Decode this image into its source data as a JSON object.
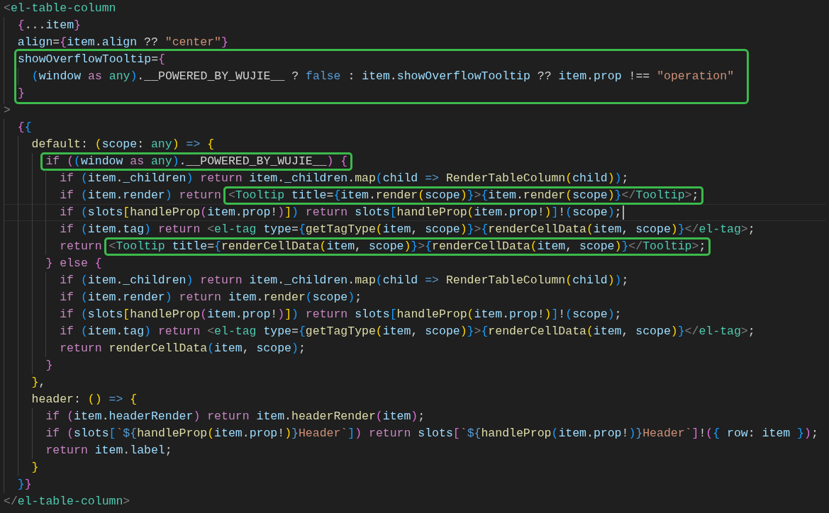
{
  "editor": {
    "lines": [
      {
        "kind": "line",
        "current": false,
        "tokens": [
          {
            "kind": "br",
            "text": "<"
          },
          {
            "kind": "tag",
            "text": "el-table-column"
          }
        ]
      },
      {
        "kind": "line",
        "current": false,
        "tokens": [
          {
            "kind": "b2",
            "text": "  {"
          },
          {
            "kind": "p",
            "text": "..."
          },
          {
            "kind": "attr",
            "text": "item"
          },
          {
            "kind": "b2",
            "text": "}"
          }
        ]
      },
      {
        "kind": "line",
        "current": false,
        "tokens": [
          {
            "kind": "attr",
            "text": "  align"
          },
          {
            "kind": "p",
            "text": "="
          },
          {
            "kind": "b2",
            "text": "{"
          },
          {
            "kind": "attr",
            "text": "item"
          },
          {
            "kind": "p",
            "text": "."
          },
          {
            "kind": "attr",
            "text": "align"
          },
          {
            "kind": "p",
            "text": " ?? "
          },
          {
            "kind": "str",
            "text": "\"center\""
          },
          {
            "kind": "b2",
            "text": "}"
          }
        ]
      },
      {
        "kind": "highlight",
        "lines": [
          {
            "kind": "line",
            "current": false,
            "tokens": [
              {
                "kind": "attr",
                "text": "  showOverflowTooltip"
              },
              {
                "kind": "p",
                "text": "="
              },
              {
                "kind": "b2",
                "text": "{"
              }
            ]
          },
          {
            "kind": "line",
            "current": false,
            "tokens": [
              {
                "kind": "b3",
                "text": "    ("
              },
              {
                "kind": "attr",
                "text": "window"
              },
              {
                "kind": "ctl",
                "text": " as "
              },
              {
                "kind": "type",
                "text": "any"
              },
              {
                "kind": "b3",
                "text": ")"
              },
              {
                "kind": "p",
                "text": ".__POWERED_BY_WUJIE__ ? "
              },
              {
                "kind": "kw",
                "text": "false"
              },
              {
                "kind": "p",
                "text": " : "
              },
              {
                "kind": "attr",
                "text": "item"
              },
              {
                "kind": "p",
                "text": "."
              },
              {
                "kind": "attr",
                "text": "showOverflowTooltip"
              },
              {
                "kind": "p",
                "text": " ?? "
              },
              {
                "kind": "attr",
                "text": "item"
              },
              {
                "kind": "p",
                "text": "."
              },
              {
                "kind": "attr",
                "text": "prop"
              },
              {
                "kind": "p",
                "text": " !== "
              },
              {
                "kind": "str",
                "text": "\"operation\""
              }
            ]
          },
          {
            "kind": "line",
            "current": false,
            "tokens": [
              {
                "kind": "b2",
                "text": "  }"
              }
            ]
          }
        ]
      },
      {
        "kind": "line",
        "current": false,
        "tokens": [
          {
            "kind": "br",
            "text": ">"
          }
        ]
      },
      {
        "kind": "line",
        "current": false,
        "tokens": [
          {
            "kind": "b2",
            "text": "  {"
          },
          {
            "kind": "b3",
            "text": "{"
          }
        ]
      },
      {
        "kind": "line",
        "current": false,
        "tokens": [
          {
            "kind": "fn",
            "text": "    default"
          },
          {
            "kind": "p",
            "text": ": "
          },
          {
            "kind": "b1",
            "text": "("
          },
          {
            "kind": "attr",
            "text": "scope"
          },
          {
            "kind": "p",
            "text": ": "
          },
          {
            "kind": "type",
            "text": "any"
          },
          {
            "kind": "b1",
            "text": ")"
          },
          {
            "kind": "kw",
            "text": " => "
          },
          {
            "kind": "b1",
            "text": "{"
          }
        ]
      },
      {
        "kind": "line",
        "current": false,
        "tokens": [
          {
            "kind": "box",
            "tokens": [
              {
                "kind": "ctl",
                "text": "      if "
              },
              {
                "kind": "b2",
                "text": "("
              },
              {
                "kind": "b3",
                "text": "("
              },
              {
                "kind": "attr",
                "text": "window"
              },
              {
                "kind": "ctl",
                "text": " as "
              },
              {
                "kind": "type",
                "text": "any"
              },
              {
                "kind": "b3",
                "text": ")"
              },
              {
                "kind": "p",
                "text": ".__POWERED_BY_WUJIE__"
              },
              {
                "kind": "b2",
                "text": ") {"
              }
            ]
          }
        ]
      },
      {
        "kind": "line",
        "current": false,
        "tokens": [
          {
            "kind": "ctl",
            "text": "        if "
          },
          {
            "kind": "b3",
            "text": "("
          },
          {
            "kind": "attr",
            "text": "item"
          },
          {
            "kind": "p",
            "text": "."
          },
          {
            "kind": "attr",
            "text": "_children"
          },
          {
            "kind": "b3",
            "text": ") "
          },
          {
            "kind": "ctl",
            "text": "return "
          },
          {
            "kind": "attr",
            "text": "item"
          },
          {
            "kind": "p",
            "text": "."
          },
          {
            "kind": "attr",
            "text": "_children"
          },
          {
            "kind": "p",
            "text": "."
          },
          {
            "kind": "fn",
            "text": "map"
          },
          {
            "kind": "b3",
            "text": "("
          },
          {
            "kind": "attr",
            "text": "child"
          },
          {
            "kind": "kw",
            "text": " => "
          },
          {
            "kind": "fn",
            "text": "RenderTableColumn"
          },
          {
            "kind": "b1",
            "text": "("
          },
          {
            "kind": "attr",
            "text": "child"
          },
          {
            "kind": "b1",
            "text": ")"
          },
          {
            "kind": "b3",
            "text": ")"
          },
          {
            "kind": "p",
            "text": ";"
          }
        ]
      },
      {
        "kind": "line",
        "current": false,
        "tokens": [
          {
            "kind": "ctl",
            "text": "        if "
          },
          {
            "kind": "b3",
            "text": "("
          },
          {
            "kind": "attr",
            "text": "item"
          },
          {
            "kind": "p",
            "text": "."
          },
          {
            "kind": "attr",
            "text": "render"
          },
          {
            "kind": "b3",
            "text": ") "
          },
          {
            "kind": "ctl",
            "text": "return "
          },
          {
            "kind": "box",
            "tokens": [
              {
                "kind": "br",
                "text": "<"
              },
              {
                "kind": "tag",
                "text": "Tooltip "
              },
              {
                "kind": "attr",
                "text": "title"
              },
              {
                "kind": "p",
                "text": "="
              },
              {
                "kind": "b3",
                "text": "{"
              },
              {
                "kind": "attr",
                "text": "item"
              },
              {
                "kind": "p",
                "text": "."
              },
              {
                "kind": "fn",
                "text": "render"
              },
              {
                "kind": "b1",
                "text": "("
              },
              {
                "kind": "attr",
                "text": "scope"
              },
              {
                "kind": "b1",
                "text": ")"
              },
              {
                "kind": "b3",
                "text": "}"
              },
              {
                "kind": "br",
                "text": ">"
              },
              {
                "kind": "b3",
                "text": "{"
              },
              {
                "kind": "attr",
                "text": "item"
              },
              {
                "kind": "p",
                "text": "."
              },
              {
                "kind": "fn",
                "text": "render"
              },
              {
                "kind": "b1",
                "text": "("
              },
              {
                "kind": "attr",
                "text": "scope"
              },
              {
                "kind": "b1",
                "text": ")"
              },
              {
                "kind": "b3",
                "text": "}"
              },
              {
                "kind": "br",
                "text": "</"
              },
              {
                "kind": "tag",
                "text": "Tooltip"
              },
              {
                "kind": "br",
                "text": ">"
              },
              {
                "kind": "p",
                "text": ";"
              }
            ]
          }
        ]
      },
      {
        "kind": "line",
        "current": true,
        "tokens": [
          {
            "kind": "ctl",
            "text": "        if "
          },
          {
            "kind": "b3",
            "text": "("
          },
          {
            "kind": "attr",
            "text": "slots"
          },
          {
            "kind": "b1",
            "text": "["
          },
          {
            "kind": "fn",
            "text": "handleProp"
          },
          {
            "kind": "b2",
            "text": "("
          },
          {
            "kind": "attr",
            "text": "item"
          },
          {
            "kind": "p",
            "text": "."
          },
          {
            "kind": "attr",
            "text": "prop"
          },
          {
            "kind": "p",
            "text": "!"
          },
          {
            "kind": "b2",
            "text": ")"
          },
          {
            "kind": "b1",
            "text": "]"
          },
          {
            "kind": "b3",
            "text": ") "
          },
          {
            "kind": "ctl",
            "text": "return "
          },
          {
            "kind": "attr",
            "text": "slots"
          },
          {
            "kind": "b3",
            "text": "["
          },
          {
            "kind": "fn",
            "text": "handleProp"
          },
          {
            "kind": "b1",
            "text": "("
          },
          {
            "kind": "attr",
            "text": "item"
          },
          {
            "kind": "p",
            "text": "."
          },
          {
            "kind": "attr",
            "text": "prop"
          },
          {
            "kind": "p",
            "text": "!"
          },
          {
            "kind": "b1",
            "text": ")"
          },
          {
            "kind": "b3",
            "text": "]"
          },
          {
            "kind": "p",
            "text": "!"
          },
          {
            "kind": "b3",
            "text": "("
          },
          {
            "kind": "attr",
            "text": "scope"
          },
          {
            "kind": "b3",
            "text": ")"
          },
          {
            "kind": "p",
            "text": ";"
          }
        ]
      },
      {
        "kind": "line",
        "current": false,
        "tokens": [
          {
            "kind": "ctl",
            "text": "        if "
          },
          {
            "kind": "b3",
            "text": "("
          },
          {
            "kind": "attr",
            "text": "item"
          },
          {
            "kind": "p",
            "text": "."
          },
          {
            "kind": "attr",
            "text": "tag"
          },
          {
            "kind": "b3",
            "text": ") "
          },
          {
            "kind": "ctl",
            "text": "return "
          },
          {
            "kind": "br",
            "text": "<"
          },
          {
            "kind": "tag",
            "text": "el-tag "
          },
          {
            "kind": "attr",
            "text": "type"
          },
          {
            "kind": "p",
            "text": "="
          },
          {
            "kind": "b3",
            "text": "{"
          },
          {
            "kind": "fn",
            "text": "getTagType"
          },
          {
            "kind": "b1",
            "text": "("
          },
          {
            "kind": "attr",
            "text": "item"
          },
          {
            "kind": "p",
            "text": ", "
          },
          {
            "kind": "attr",
            "text": "scope"
          },
          {
            "kind": "b1",
            "text": ")"
          },
          {
            "kind": "b3",
            "text": "}"
          },
          {
            "kind": "br",
            "text": ">"
          },
          {
            "kind": "b3",
            "text": "{"
          },
          {
            "kind": "fn",
            "text": "renderCellData"
          },
          {
            "kind": "b1",
            "text": "("
          },
          {
            "kind": "attr",
            "text": "item"
          },
          {
            "kind": "p",
            "text": ", "
          },
          {
            "kind": "attr",
            "text": "scope"
          },
          {
            "kind": "b1",
            "text": ")"
          },
          {
            "kind": "b3",
            "text": "}"
          },
          {
            "kind": "br",
            "text": "</"
          },
          {
            "kind": "tag",
            "text": "el-tag"
          },
          {
            "kind": "br",
            "text": ">"
          },
          {
            "kind": "p",
            "text": ";"
          }
        ]
      },
      {
        "kind": "line",
        "current": false,
        "tokens": [
          {
            "kind": "ctl",
            "text": "        return "
          },
          {
            "kind": "box",
            "tokens": [
              {
                "kind": "br",
                "text": "<"
              },
              {
                "kind": "tag",
                "text": "Tooltip "
              },
              {
                "kind": "attr",
                "text": "title"
              },
              {
                "kind": "p",
                "text": "="
              },
              {
                "kind": "b3",
                "text": "{"
              },
              {
                "kind": "fn",
                "text": "renderCellData"
              },
              {
                "kind": "b1",
                "text": "("
              },
              {
                "kind": "attr",
                "text": "item"
              },
              {
                "kind": "p",
                "text": ", "
              },
              {
                "kind": "attr",
                "text": "scope"
              },
              {
                "kind": "b1",
                "text": ")"
              },
              {
                "kind": "b3",
                "text": "}"
              },
              {
                "kind": "br",
                "text": ">"
              },
              {
                "kind": "b3",
                "text": "{"
              },
              {
                "kind": "fn",
                "text": "renderCellData"
              },
              {
                "kind": "b1",
                "text": "("
              },
              {
                "kind": "attr",
                "text": "item"
              },
              {
                "kind": "p",
                "text": ", "
              },
              {
                "kind": "attr",
                "text": "scope"
              },
              {
                "kind": "b1",
                "text": ")"
              },
              {
                "kind": "b3",
                "text": "}"
              },
              {
                "kind": "br",
                "text": "</"
              },
              {
                "kind": "tag",
                "text": "Tooltip"
              },
              {
                "kind": "br",
                "text": ">"
              },
              {
                "kind": "p",
                "text": ";"
              }
            ]
          }
        ]
      },
      {
        "kind": "line",
        "current": false,
        "tokens": [
          {
            "kind": "b2",
            "text": "      } "
          },
          {
            "kind": "ctl",
            "text": "else "
          },
          {
            "kind": "b2",
            "text": "{"
          }
        ]
      },
      {
        "kind": "line",
        "current": false,
        "tokens": [
          {
            "kind": "ctl",
            "text": "        if "
          },
          {
            "kind": "b3",
            "text": "("
          },
          {
            "kind": "attr",
            "text": "item"
          },
          {
            "kind": "p",
            "text": "."
          },
          {
            "kind": "attr",
            "text": "_children"
          },
          {
            "kind": "b3",
            "text": ") "
          },
          {
            "kind": "ctl",
            "text": "return "
          },
          {
            "kind": "attr",
            "text": "item"
          },
          {
            "kind": "p",
            "text": "."
          },
          {
            "kind": "attr",
            "text": "_children"
          },
          {
            "kind": "p",
            "text": "."
          },
          {
            "kind": "fn",
            "text": "map"
          },
          {
            "kind": "b3",
            "text": "("
          },
          {
            "kind": "attr",
            "text": "child"
          },
          {
            "kind": "kw",
            "text": " => "
          },
          {
            "kind": "fn",
            "text": "RenderTableColumn"
          },
          {
            "kind": "b1",
            "text": "("
          },
          {
            "kind": "attr",
            "text": "child"
          },
          {
            "kind": "b1",
            "text": ")"
          },
          {
            "kind": "b3",
            "text": ")"
          },
          {
            "kind": "p",
            "text": ";"
          }
        ]
      },
      {
        "kind": "line",
        "current": false,
        "tokens": [
          {
            "kind": "ctl",
            "text": "        if "
          },
          {
            "kind": "b3",
            "text": "("
          },
          {
            "kind": "attr",
            "text": "item"
          },
          {
            "kind": "p",
            "text": "."
          },
          {
            "kind": "attr",
            "text": "render"
          },
          {
            "kind": "b3",
            "text": ") "
          },
          {
            "kind": "ctl",
            "text": "return "
          },
          {
            "kind": "attr",
            "text": "item"
          },
          {
            "kind": "p",
            "text": "."
          },
          {
            "kind": "fn",
            "text": "render"
          },
          {
            "kind": "b3",
            "text": "("
          },
          {
            "kind": "attr",
            "text": "scope"
          },
          {
            "kind": "b3",
            "text": ")"
          },
          {
            "kind": "p",
            "text": ";"
          }
        ]
      },
      {
        "kind": "line",
        "current": false,
        "tokens": [
          {
            "kind": "ctl",
            "text": "        if "
          },
          {
            "kind": "b3",
            "text": "("
          },
          {
            "kind": "attr",
            "text": "slots"
          },
          {
            "kind": "b1",
            "text": "["
          },
          {
            "kind": "fn",
            "text": "handleProp"
          },
          {
            "kind": "b2",
            "text": "("
          },
          {
            "kind": "attr",
            "text": "item"
          },
          {
            "kind": "p",
            "text": "."
          },
          {
            "kind": "attr",
            "text": "prop"
          },
          {
            "kind": "p",
            "text": "!"
          },
          {
            "kind": "b2",
            "text": ")"
          },
          {
            "kind": "b1",
            "text": "]"
          },
          {
            "kind": "b3",
            "text": ") "
          },
          {
            "kind": "ctl",
            "text": "return "
          },
          {
            "kind": "attr",
            "text": "slots"
          },
          {
            "kind": "b3",
            "text": "["
          },
          {
            "kind": "fn",
            "text": "handleProp"
          },
          {
            "kind": "b1",
            "text": "("
          },
          {
            "kind": "attr",
            "text": "item"
          },
          {
            "kind": "p",
            "text": "."
          },
          {
            "kind": "attr",
            "text": "prop"
          },
          {
            "kind": "p",
            "text": "!"
          },
          {
            "kind": "b1",
            "text": ")"
          },
          {
            "kind": "b3",
            "text": "]"
          },
          {
            "kind": "p",
            "text": "!"
          },
          {
            "kind": "b3",
            "text": "("
          },
          {
            "kind": "attr",
            "text": "scope"
          },
          {
            "kind": "b3",
            "text": ")"
          },
          {
            "kind": "p",
            "text": ";"
          }
        ]
      },
      {
        "kind": "line",
        "current": false,
        "tokens": [
          {
            "kind": "ctl",
            "text": "        if "
          },
          {
            "kind": "b3",
            "text": "("
          },
          {
            "kind": "attr",
            "text": "item"
          },
          {
            "kind": "p",
            "text": "."
          },
          {
            "kind": "attr",
            "text": "tag"
          },
          {
            "kind": "b3",
            "text": ") "
          },
          {
            "kind": "ctl",
            "text": "return "
          },
          {
            "kind": "br",
            "text": "<"
          },
          {
            "kind": "tag",
            "text": "el-tag "
          },
          {
            "kind": "attr",
            "text": "type"
          },
          {
            "kind": "p",
            "text": "="
          },
          {
            "kind": "b3",
            "text": "{"
          },
          {
            "kind": "fn",
            "text": "getTagType"
          },
          {
            "kind": "b1",
            "text": "("
          },
          {
            "kind": "attr",
            "text": "item"
          },
          {
            "kind": "p",
            "text": ", "
          },
          {
            "kind": "attr",
            "text": "scope"
          },
          {
            "kind": "b1",
            "text": ")"
          },
          {
            "kind": "b3",
            "text": "}"
          },
          {
            "kind": "br",
            "text": ">"
          },
          {
            "kind": "b3",
            "text": "{"
          },
          {
            "kind": "fn",
            "text": "renderCellData"
          },
          {
            "kind": "b1",
            "text": "("
          },
          {
            "kind": "attr",
            "text": "item"
          },
          {
            "kind": "p",
            "text": ", "
          },
          {
            "kind": "attr",
            "text": "scope"
          },
          {
            "kind": "b1",
            "text": ")"
          },
          {
            "kind": "b3",
            "text": "}"
          },
          {
            "kind": "br",
            "text": "</"
          },
          {
            "kind": "tag",
            "text": "el-tag"
          },
          {
            "kind": "br",
            "text": ">"
          },
          {
            "kind": "p",
            "text": ";"
          }
        ]
      },
      {
        "kind": "line",
        "current": false,
        "tokens": [
          {
            "kind": "ctl",
            "text": "        return "
          },
          {
            "kind": "fn",
            "text": "renderCellData"
          },
          {
            "kind": "b3",
            "text": "("
          },
          {
            "kind": "attr",
            "text": "item"
          },
          {
            "kind": "p",
            "text": ", "
          },
          {
            "kind": "attr",
            "text": "scope"
          },
          {
            "kind": "b3",
            "text": ")"
          },
          {
            "kind": "p",
            "text": ";"
          }
        ]
      },
      {
        "kind": "line",
        "current": false,
        "tokens": [
          {
            "kind": "b2",
            "text": "      }"
          }
        ]
      },
      {
        "kind": "line",
        "current": false,
        "tokens": [
          {
            "kind": "b1",
            "text": "    }"
          },
          {
            "kind": "p",
            "text": ","
          }
        ]
      },
      {
        "kind": "line",
        "current": false,
        "tokens": [
          {
            "kind": "fn",
            "text": "    header"
          },
          {
            "kind": "p",
            "text": ": "
          },
          {
            "kind": "b1",
            "text": "()"
          },
          {
            "kind": "kw",
            "text": " => "
          },
          {
            "kind": "b1",
            "text": "{"
          }
        ]
      },
      {
        "kind": "line",
        "current": false,
        "tokens": [
          {
            "kind": "ctl",
            "text": "      if "
          },
          {
            "kind": "b2",
            "text": "("
          },
          {
            "kind": "attr",
            "text": "item"
          },
          {
            "kind": "p",
            "text": "."
          },
          {
            "kind": "attr",
            "text": "headerRender"
          },
          {
            "kind": "b2",
            "text": ") "
          },
          {
            "kind": "ctl",
            "text": "return "
          },
          {
            "kind": "attr",
            "text": "item"
          },
          {
            "kind": "p",
            "text": "."
          },
          {
            "kind": "fn",
            "text": "headerRender"
          },
          {
            "kind": "b2",
            "text": "("
          },
          {
            "kind": "attr",
            "text": "item"
          },
          {
            "kind": "b2",
            "text": ")"
          },
          {
            "kind": "p",
            "text": ";"
          }
        ]
      },
      {
        "kind": "line",
        "current": false,
        "tokens": [
          {
            "kind": "ctl",
            "text": "      if "
          },
          {
            "kind": "b2",
            "text": "("
          },
          {
            "kind": "attr",
            "text": "slots"
          },
          {
            "kind": "b3",
            "text": "["
          },
          {
            "kind": "str",
            "text": "`"
          },
          {
            "kind": "kw",
            "text": "${"
          },
          {
            "kind": "fn",
            "text": "handleProp"
          },
          {
            "kind": "b1",
            "text": "("
          },
          {
            "kind": "attr",
            "text": "item"
          },
          {
            "kind": "p",
            "text": "."
          },
          {
            "kind": "attr",
            "text": "prop"
          },
          {
            "kind": "p",
            "text": "!"
          },
          {
            "kind": "b1",
            "text": ")"
          },
          {
            "kind": "kw",
            "text": "}"
          },
          {
            "kind": "str",
            "text": "Header`"
          },
          {
            "kind": "b3",
            "text": "]"
          },
          {
            "kind": "b2",
            "text": ") "
          },
          {
            "kind": "ctl",
            "text": "return "
          },
          {
            "kind": "attr",
            "text": "slots"
          },
          {
            "kind": "b2",
            "text": "["
          },
          {
            "kind": "str",
            "text": "`"
          },
          {
            "kind": "kw",
            "text": "${"
          },
          {
            "kind": "fn",
            "text": "handleProp"
          },
          {
            "kind": "b3",
            "text": "("
          },
          {
            "kind": "attr",
            "text": "item"
          },
          {
            "kind": "p",
            "text": "."
          },
          {
            "kind": "attr",
            "text": "prop"
          },
          {
            "kind": "p",
            "text": "!"
          },
          {
            "kind": "b3",
            "text": ")"
          },
          {
            "kind": "kw",
            "text": "}"
          },
          {
            "kind": "str",
            "text": "Header`"
          },
          {
            "kind": "b2",
            "text": "]"
          },
          {
            "kind": "p",
            "text": "!"
          },
          {
            "kind": "b2",
            "text": "("
          },
          {
            "kind": "b3",
            "text": "{ "
          },
          {
            "kind": "attr",
            "text": "row"
          },
          {
            "kind": "p",
            "text": ": "
          },
          {
            "kind": "attr",
            "text": "item "
          },
          {
            "kind": "b3",
            "text": "}"
          },
          {
            "kind": "b2",
            "text": ")"
          },
          {
            "kind": "p",
            "text": ";"
          }
        ]
      },
      {
        "kind": "line",
        "current": false,
        "tokens": [
          {
            "kind": "ctl",
            "text": "      return "
          },
          {
            "kind": "attr",
            "text": "item"
          },
          {
            "kind": "p",
            "text": "."
          },
          {
            "kind": "attr",
            "text": "label"
          },
          {
            "kind": "p",
            "text": ";"
          }
        ]
      },
      {
        "kind": "line",
        "current": false,
        "tokens": [
          {
            "kind": "b1",
            "text": "    }"
          }
        ]
      },
      {
        "kind": "line",
        "current": false,
        "tokens": [
          {
            "kind": "b3",
            "text": "  }"
          },
          {
            "kind": "b2",
            "text": "}"
          }
        ]
      },
      {
        "kind": "line",
        "current": false,
        "tokens": [
          {
            "kind": "br",
            "text": "</"
          },
          {
            "kind": "tag",
            "text": "el-table-column"
          },
          {
            "kind": "br",
            "text": ">"
          }
        ]
      }
    ]
  }
}
